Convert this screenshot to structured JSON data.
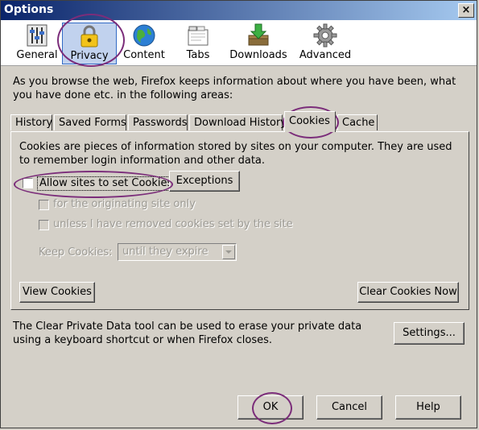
{
  "window": {
    "title": "Options",
    "close_label": "×"
  },
  "toolbar": {
    "items": [
      {
        "label": "General"
      },
      {
        "label": "Privacy"
      },
      {
        "label": "Content"
      },
      {
        "label": "Tabs"
      },
      {
        "label": "Downloads"
      },
      {
        "label": "Advanced"
      }
    ]
  },
  "intro_text": "As you browse the web, Firefox keeps information about where you have been, what you have done etc. in the following areas:",
  "tabs": [
    {
      "label": "History"
    },
    {
      "label": "Saved Forms"
    },
    {
      "label": "Passwords"
    },
    {
      "label": "Download History"
    },
    {
      "label": "Cookies"
    },
    {
      "label": "Cache"
    }
  ],
  "cookies": {
    "description": "Cookies are pieces of information stored by sites on your computer. They are used to remember login information and other data.",
    "allow_label": "Allow sites to set Cookies",
    "exceptions_label": "Exceptions",
    "originating_label": "for the originating site only",
    "unless_label": "unless I have removed cookies set by the site",
    "keep_label": "Keep Cookies:",
    "keep_value": "until they expire",
    "view_label": "View Cookies",
    "clear_label": "Clear Cookies Now"
  },
  "clear_private": {
    "text": "The Clear Private Data tool can be used to erase your private data using a keyboard shortcut or when Firefox closes.",
    "settings_label": "Settings..."
  },
  "footer": {
    "ok_label": "OK",
    "cancel_label": "Cancel",
    "help_label": "Help"
  }
}
